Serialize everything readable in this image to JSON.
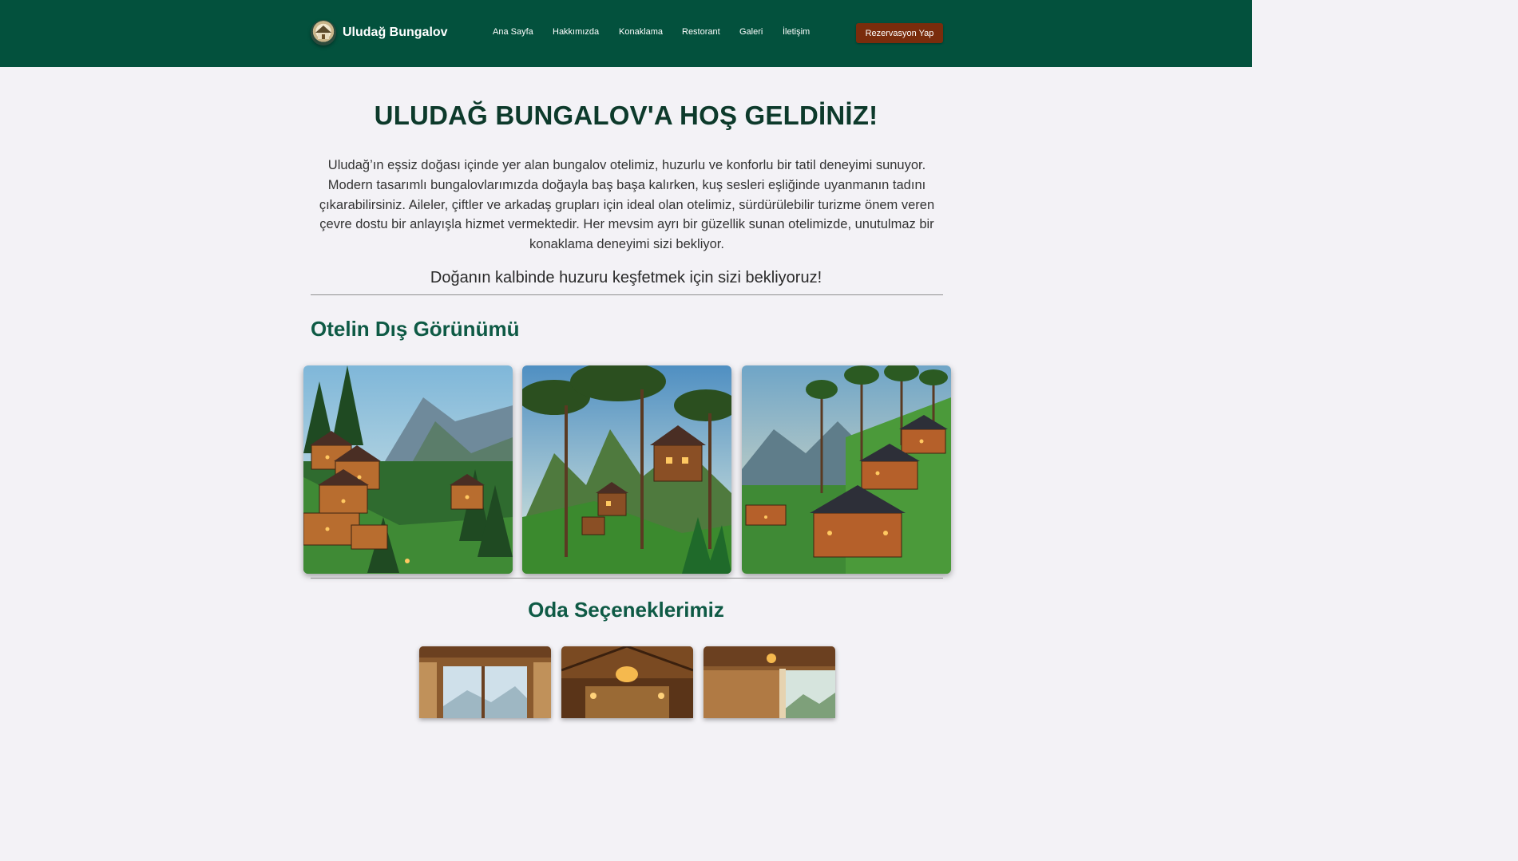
{
  "header": {
    "brand_name": "Uludağ Bungalov",
    "logo_icon": "bungalow-logo-icon",
    "nav": [
      "Ana Sayfa",
      "Hakkımızda",
      "Konaklama",
      "Restorant",
      "Galeri",
      "İletişim"
    ],
    "cta_label": "Rezervasyon Yap",
    "colors": {
      "header_bg": "#03513d",
      "cta_bg": "#7a2c0c"
    }
  },
  "main": {
    "title": "ULUDAĞ BUNGALOV'A HOŞ GELDİNİZ!",
    "intro": "Uludağ’ın eşsiz doğası içinde yer alan bungalov otelimiz, huzurlu ve konforlu bir tatil deneyimi sunuyor. Modern tasarımlı bungalovlarımızda doğayla baş başa kalırken, kuş sesleri eşliğinde uyanmanın tadını çıkarabilirsiniz. Aileler, çiftler ve arkadaş grupları için ideal olan otelimiz, sürdürülebilir turizme önem veren çevre dostu bir anlayışla hizmet vermektedir. Her mevsim ayrı bir güzellik sunan otelimizde, unutulmaz bir konaklama deneyimi sizi bekliyor.",
    "tagline": "Doğanın kalbinde huzuru keşfetmek için sizi bekliyoruz!",
    "exterior_title": "Otelin Dış Görünümü",
    "rooms_title": "Oda Seçeneklerimiz",
    "accent_color": "#0e5a45"
  }
}
